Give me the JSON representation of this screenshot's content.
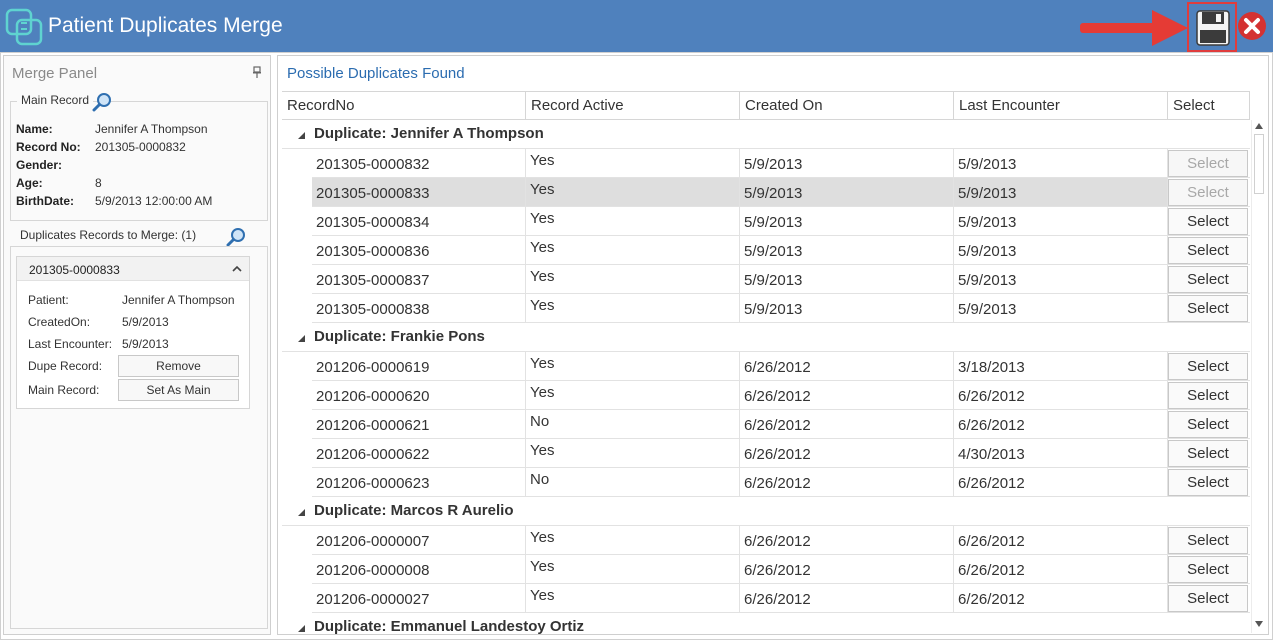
{
  "window": {
    "title": "Patient Duplicates Merge",
    "accent_color": "#4f81bd",
    "highlight_color": "#e03c3c",
    "icons": [
      "app-logo-icon",
      "arrow-icon",
      "save-icon",
      "close-icon"
    ]
  },
  "merge_panel": {
    "title": "Merge Panel",
    "main_record": {
      "legend": "Main Record",
      "fields": [
        {
          "key": "Name:",
          "value": "Jennifer A Thompson"
        },
        {
          "key": "Record No:",
          "value": "201305-0000832"
        },
        {
          "key": "Gender:",
          "value": ""
        },
        {
          "key": "Age:",
          "value": "8"
        },
        {
          "key": "BirthDate:",
          "value": "5/9/2013 12:00:00 AM"
        }
      ]
    },
    "duplicates": {
      "legend": "Duplicates Records to Merge: (1)",
      "card": {
        "record_no": "201305-0000833",
        "patient_label": "Patient:",
        "patient_value": "Jennifer A Thompson",
        "created_label": "CreatedOn:",
        "created_value": "5/9/2013",
        "encounter_label": "Last Encounter:",
        "encounter_value": "5/9/2013",
        "dupe_label": "Dupe Record:",
        "remove_button": "Remove",
        "main_label": "Main Record:",
        "set_main_button": "Set As Main"
      }
    }
  },
  "grid": {
    "title": "Possible Duplicates Found",
    "columns": [
      "RecordNo",
      "Record Active",
      "Created On",
      "Last Encounter",
      "Select"
    ],
    "select_label": "Select",
    "groups": [
      {
        "label": "Duplicate: Jennifer A Thompson",
        "rows": [
          {
            "record": "201305-0000832",
            "active": "Yes",
            "created": "5/9/2013",
            "encounter": "5/9/2013",
            "select_disabled": true,
            "highlighted": false
          },
          {
            "record": "201305-0000833",
            "active": "Yes",
            "created": "5/9/2013",
            "encounter": "5/9/2013",
            "select_disabled": true,
            "highlighted": true
          },
          {
            "record": "201305-0000834",
            "active": "Yes",
            "created": "5/9/2013",
            "encounter": "5/9/2013",
            "select_disabled": false,
            "highlighted": false
          },
          {
            "record": "201305-0000836",
            "active": "Yes",
            "created": "5/9/2013",
            "encounter": "5/9/2013",
            "select_disabled": false,
            "highlighted": false
          },
          {
            "record": "201305-0000837",
            "active": "Yes",
            "created": "5/9/2013",
            "encounter": "5/9/2013",
            "select_disabled": false,
            "highlighted": false
          },
          {
            "record": "201305-0000838",
            "active": "Yes",
            "created": "5/9/2013",
            "encounter": "5/9/2013",
            "select_disabled": false,
            "highlighted": false
          }
        ]
      },
      {
        "label": "Duplicate: Frankie Pons",
        "rows": [
          {
            "record": "201206-0000619",
            "active": "Yes",
            "created": "6/26/2012",
            "encounter": "3/18/2013",
            "select_disabled": false,
            "highlighted": false
          },
          {
            "record": "201206-0000620",
            "active": "Yes",
            "created": "6/26/2012",
            "encounter": "6/26/2012",
            "select_disabled": false,
            "highlighted": false
          },
          {
            "record": "201206-0000621",
            "active": "No",
            "created": "6/26/2012",
            "encounter": "6/26/2012",
            "select_disabled": false,
            "highlighted": false
          },
          {
            "record": "201206-0000622",
            "active": "Yes",
            "created": "6/26/2012",
            "encounter": "4/30/2013",
            "select_disabled": false,
            "highlighted": false
          },
          {
            "record": "201206-0000623",
            "active": "No",
            "created": "6/26/2012",
            "encounter": "6/26/2012",
            "select_disabled": false,
            "highlighted": false
          }
        ]
      },
      {
        "label": "Duplicate: Marcos R Aurelio",
        "rows": [
          {
            "record": "201206-0000007",
            "active": "Yes",
            "created": "6/26/2012",
            "encounter": "6/26/2012",
            "select_disabled": false,
            "highlighted": false
          },
          {
            "record": "201206-0000008",
            "active": "Yes",
            "created": "6/26/2012",
            "encounter": "6/26/2012",
            "select_disabled": false,
            "highlighted": false
          },
          {
            "record": "201206-0000027",
            "active": "Yes",
            "created": "6/26/2012",
            "encounter": "6/26/2012",
            "select_disabled": false,
            "highlighted": false
          }
        ]
      },
      {
        "label": "Duplicate: Emmanuel Landestoy Ortiz",
        "rows": []
      }
    ]
  }
}
